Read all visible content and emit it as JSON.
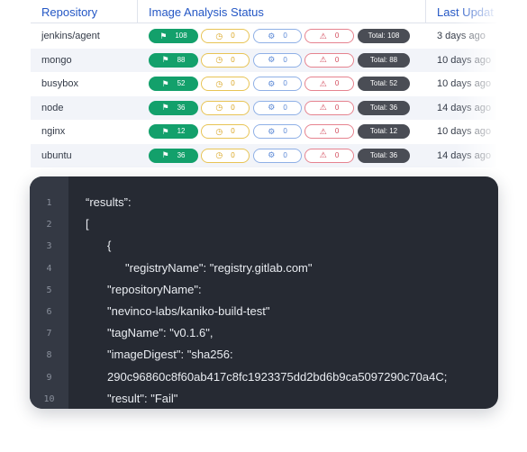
{
  "table": {
    "headers": {
      "repository": "Repository",
      "status": "Image Analysis Status",
      "updated": "Last Updat"
    },
    "rows": [
      {
        "repository": "jenkins/agent",
        "passed": "108",
        "pending": "0",
        "scanning": "0",
        "failed": "0",
        "total": "Total: 108",
        "updated": "3 days ago"
      },
      {
        "repository": "mongo",
        "passed": "88",
        "pending": "0",
        "scanning": "0",
        "failed": "0",
        "total": "Total: 88",
        "updated": "10 days ago"
      },
      {
        "repository": "busybox",
        "passed": "52",
        "pending": "0",
        "scanning": "0",
        "failed": "0",
        "total": "Total: 52",
        "updated": "10 days ago"
      },
      {
        "repository": "node",
        "passed": "36",
        "pending": "0",
        "scanning": "0",
        "failed": "0",
        "total": "Total: 36",
        "updated": "14 days ago"
      },
      {
        "repository": "nginx",
        "passed": "12",
        "pending": "0",
        "scanning": "0",
        "failed": "0",
        "total": "Total: 12",
        "updated": "10 days ago"
      },
      {
        "repository": "ubuntu",
        "passed": "36",
        "pending": "0",
        "scanning": "0",
        "failed": "0",
        "total": "Total: 36",
        "updated": "14 days ago"
      }
    ],
    "icons": {
      "passed": "flag-icon",
      "pending": "clock-icon",
      "scanning": "gear-icon",
      "failed": "warning-icon"
    },
    "colors": {
      "header_text": "#2457c5",
      "passed": "#13a06b",
      "pending": "#e8c455",
      "scanning": "#8fb0e6",
      "failed": "#e6838f",
      "total": "#4a4d55"
    }
  },
  "code": {
    "line_numbers": [
      "1",
      "2",
      "3",
      "4",
      "5",
      "6",
      "7",
      "8",
      "9",
      "10"
    ],
    "lines": [
      "“results”:",
      "[",
      "{",
      "\"registryName\": \"registry.gitlab.com\"",
      "\"repositoryName\":",
      "\"nevinco-labs/kaniko-build-test\"",
      "\"tagName\": \"v0.1.6\",",
      "\"imageDigest\": \"sha256:",
      "290c96860c8f60ab417c8fc1923375dd2bd6b9ca5097290c70a4C;",
      "\"result\": \"Fail\""
    ],
    "colors": {
      "background": "#262a33",
      "gutter": "#343944"
    }
  }
}
